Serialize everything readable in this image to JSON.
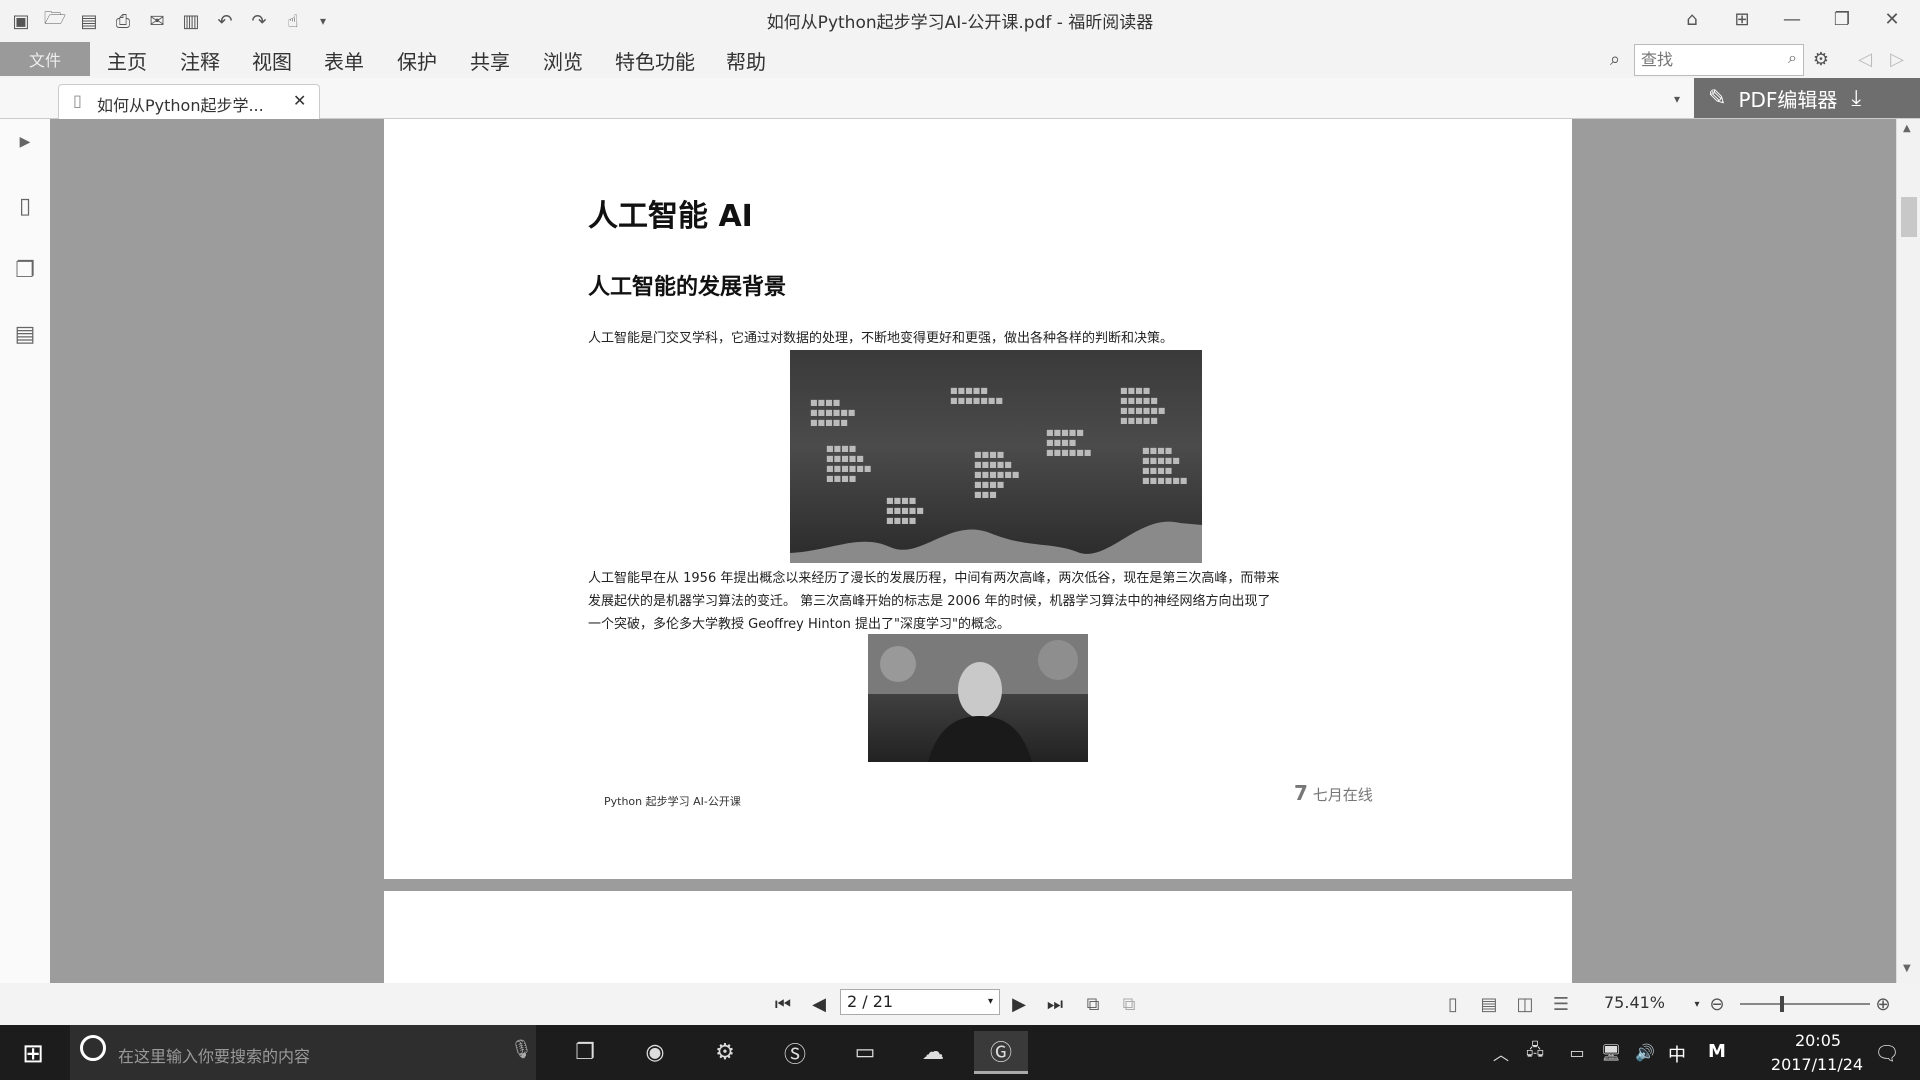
{
  "window": {
    "title": "如何从Python起步学习AI-公开课.pdf - 福昕阅读器"
  },
  "menu": {
    "file_label": "文件",
    "items": [
      "主页",
      "注释",
      "视图",
      "表单",
      "保护",
      "共享",
      "浏览",
      "特色功能",
      "帮助"
    ]
  },
  "search": {
    "placeholder": "查找"
  },
  "tab": {
    "label": "如何从Python起步学..."
  },
  "promo": {
    "label": "PDF编辑器"
  },
  "document": {
    "title": "人工智能 AI",
    "section_heading": "人工智能的发展背景",
    "para1": "人工智能是门交叉学科，它通过对数据的处理，不断地变得更好和更强，做出各种各样的判断和决策。",
    "para2_line1": "人工智能早在从 1956 年提出概念以来经历了漫长的发展历程，中间有两次高峰，两次低谷，现在是第三次高峰，而带来",
    "para2_line2": "发展起伏的是机器学习算法的变迁。 第三次高峰开始的标志是 2006 年的时候，机器学习算法中的神经网络方向出现了",
    "para2_line3": "一个突破，多伦多大学教授 Geoffrey Hinton 提出了\"深度学习\"的概念。",
    "footer_left": "Python 起步学习 AI-公开课",
    "footer_logo": "七月在线"
  },
  "statusbar": {
    "page_value": "2 / 21",
    "zoom": "75.41%"
  },
  "taskbar": {
    "search_placeholder": "在这里输入你要搜索的内容",
    "ime": "中",
    "ime_mode": "M",
    "time": "20:05",
    "date": "2017/11/24"
  },
  "colors": {
    "menu_bg": "#f3f3f3",
    "doc_bg": "#9c9c9c",
    "taskbar_bg": "#1c1c1c",
    "promo_bg": "#6e6e6e"
  }
}
